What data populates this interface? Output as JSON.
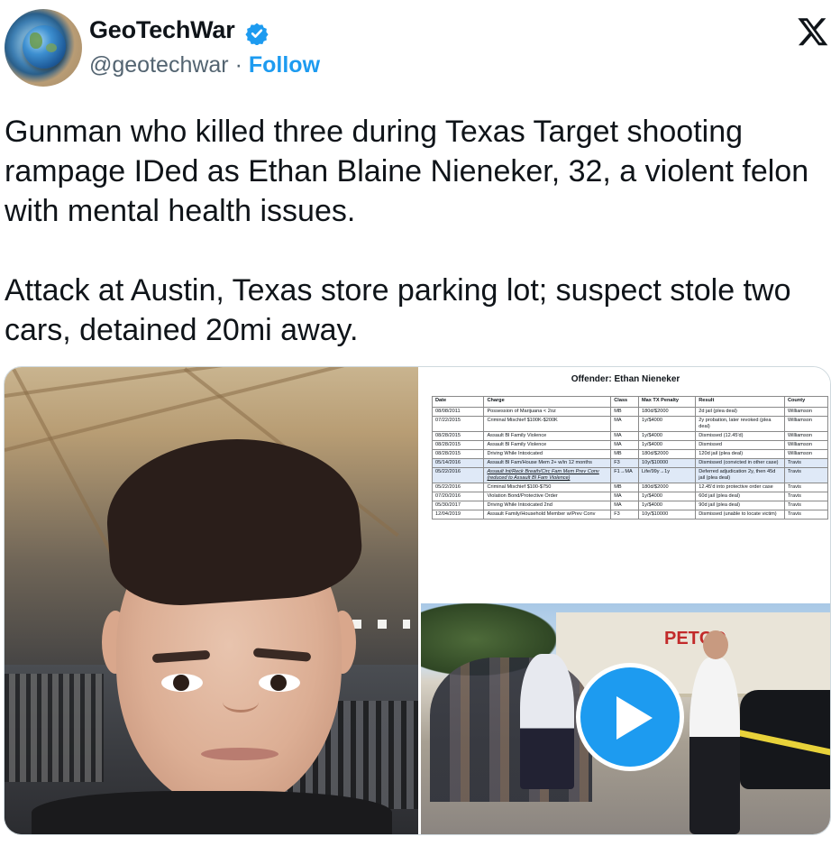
{
  "author": {
    "name": "GeoTechWar",
    "handle": "@geotechwar",
    "separator": " · ",
    "follow_label": "Follow"
  },
  "tweet": {
    "text": "Gunman who killed three during Texas Target shooting rampage IDed as Ethan Blaine Nieneker, 32, a violent felon with mental health issues.\n\nAttack at Austin, Texas store parking lot; suspect stole two cars, detained 20mi away."
  },
  "document": {
    "title": "Offender: Ethan Nieneker",
    "headers": [
      "Date",
      "Charge",
      "Class",
      "Max TX Penalty",
      "Result",
      "County"
    ],
    "rows": [
      {
        "date": "08/08/2011",
        "charge": "Possession of Marijuana < 2oz",
        "class": "MB",
        "penalty": "180d/$2000",
        "result": "2d jail (plea deal)",
        "county": "Williamson"
      },
      {
        "date": "07/22/2015",
        "charge": "Criminal Mischief $100K-$200K",
        "class": "MA",
        "penalty": "1y/$4000",
        "result": "2y probation, later revoked (plea deal)",
        "county": "Williamson"
      },
      {
        "date": "08/28/2015",
        "charge": "Assault Bl Family Violence",
        "class": "MA",
        "penalty": "1y/$4000",
        "result": "Dismissed (12.45'd)",
        "county": "Williamson"
      },
      {
        "date": "08/28/2015",
        "charge": "Assault Bl Family Violence",
        "class": "MA",
        "penalty": "1y/$4000",
        "result": "Dismissed",
        "county": "Williamson"
      },
      {
        "date": "08/28/2015",
        "charge": "Driving While Intoxicated",
        "class": "MB",
        "penalty": "180d/$2000",
        "result": "120d jail (plea deal)",
        "county": "Williamson"
      },
      {
        "date": "05/14/2016",
        "charge": "Assault Bl Fam/House Mem 2+ w/in 12 months",
        "class": "F3",
        "penalty": "10y/$10000",
        "result": "Dismissed (convicted in other case)",
        "county": "Travis"
      },
      {
        "date": "05/22/2016",
        "charge": "Assault Int/Reck Breath/Circ Fam Mem Prev Conv (reduced to Assault Bl Fam Violence)",
        "class": "F1→MA",
        "penalty": "Life/99y→1y",
        "result": "Deferred adjudication 2y, then 45d jail (plea deal)",
        "county": "Travis"
      },
      {
        "date": "05/22/2016",
        "charge": "Criminal Mischief $100-$750",
        "class": "MB",
        "penalty": "180d/$2000",
        "result": "12.45'd into protective order case",
        "county": "Travis"
      },
      {
        "date": "07/20/2016",
        "charge": "Violation Bond/Protective Order",
        "class": "MA",
        "penalty": "1y/$4000",
        "result": "60d jail (plea deal)",
        "county": "Travis"
      },
      {
        "date": "05/30/2017",
        "charge": "Driving While Intoxicated 2nd",
        "class": "MA",
        "penalty": "1y/$4000",
        "result": "90d jail (plea deal)",
        "county": "Travis"
      },
      {
        "date": "12/04/2019",
        "charge": "Assault Family/Household Member w/Prev Conv",
        "class": "F3",
        "penalty": "10y/$10000",
        "result": "Dismissed (unable to locate victim)",
        "county": "Travis"
      }
    ]
  },
  "video": {
    "store_sign": "PETCO"
  },
  "colors": {
    "accent": "#1d9bf0",
    "text": "#0f1419",
    "muted": "#536471"
  }
}
